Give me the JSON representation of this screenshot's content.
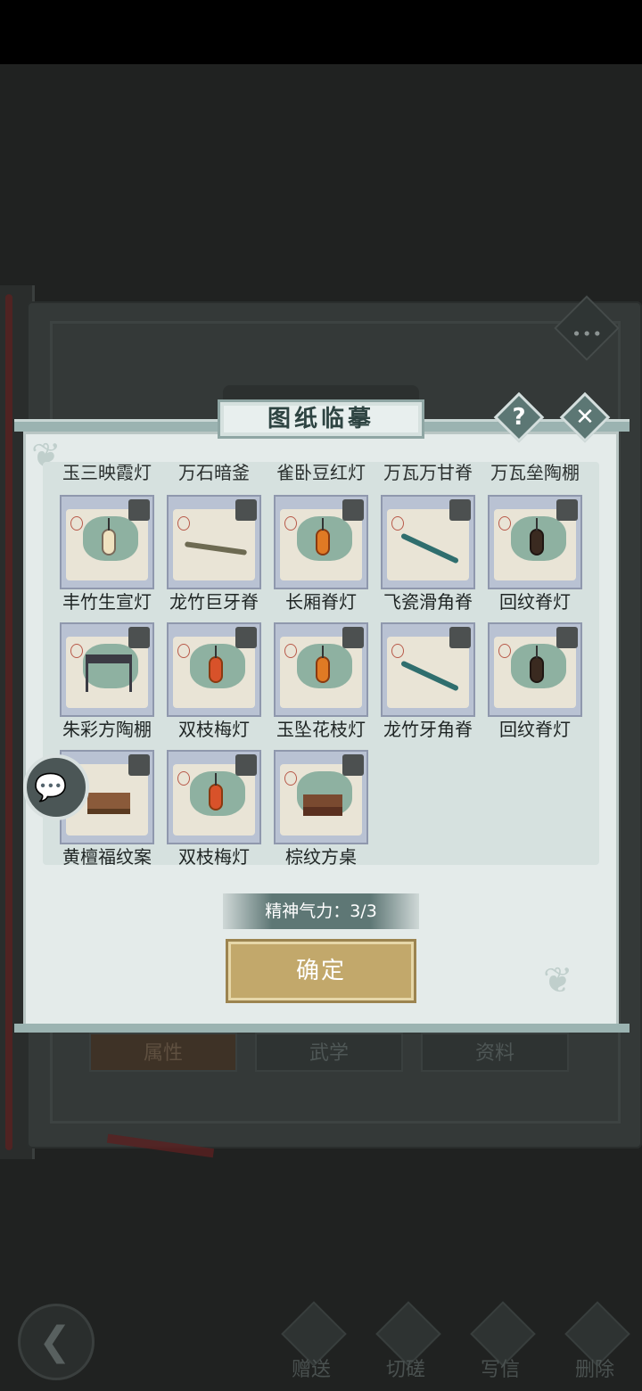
{
  "dialog": {
    "title": "图纸临摹",
    "help_icon": "?",
    "close_icon": "✕"
  },
  "cut_row": [
    "玉三映霞灯",
    "万石暗釜",
    "雀卧豆红灯",
    "万瓦万甘脊",
    "万瓦垒陶棚"
  ],
  "items": [
    {
      "name": "丰竹生宣灯",
      "icon": "pale-lantern"
    },
    {
      "name": "龙竹巨牙脊",
      "icon": "bamboo-beam"
    },
    {
      "name": "长厢脊灯",
      "icon": "orange-lantern"
    },
    {
      "name": "飞瓷滑角脊",
      "icon": "teal-ridge"
    },
    {
      "name": "回纹脊灯",
      "icon": "dark-lantern"
    },
    {
      "name": "朱彩方陶棚",
      "icon": "pavilion"
    },
    {
      "name": "双枝梅灯",
      "icon": "red-lantern"
    },
    {
      "name": "玉坠花枝灯",
      "icon": "orange-lantern"
    },
    {
      "name": "龙竹牙角脊",
      "icon": "teal-ridge"
    },
    {
      "name": "回纹脊灯",
      "icon": "dark-lantern"
    },
    {
      "name": "黄檀福纹案",
      "icon": "desk"
    },
    {
      "name": "双枝梅灯",
      "icon": "red-lantern"
    },
    {
      "name": "棕纹方桌",
      "icon": "table"
    }
  ],
  "stamina_text": "精神气力：3/3",
  "confirm_label": "确定",
  "background_tabs": [
    "属性",
    "武学",
    "资料"
  ],
  "bottom_nav": [
    "赠送",
    "切磋",
    "写信",
    "删除"
  ],
  "colors": {
    "accent_teal": "#5c7774",
    "confirm_gold": "#c2a86b",
    "panel_bg": "#e4ebea"
  }
}
